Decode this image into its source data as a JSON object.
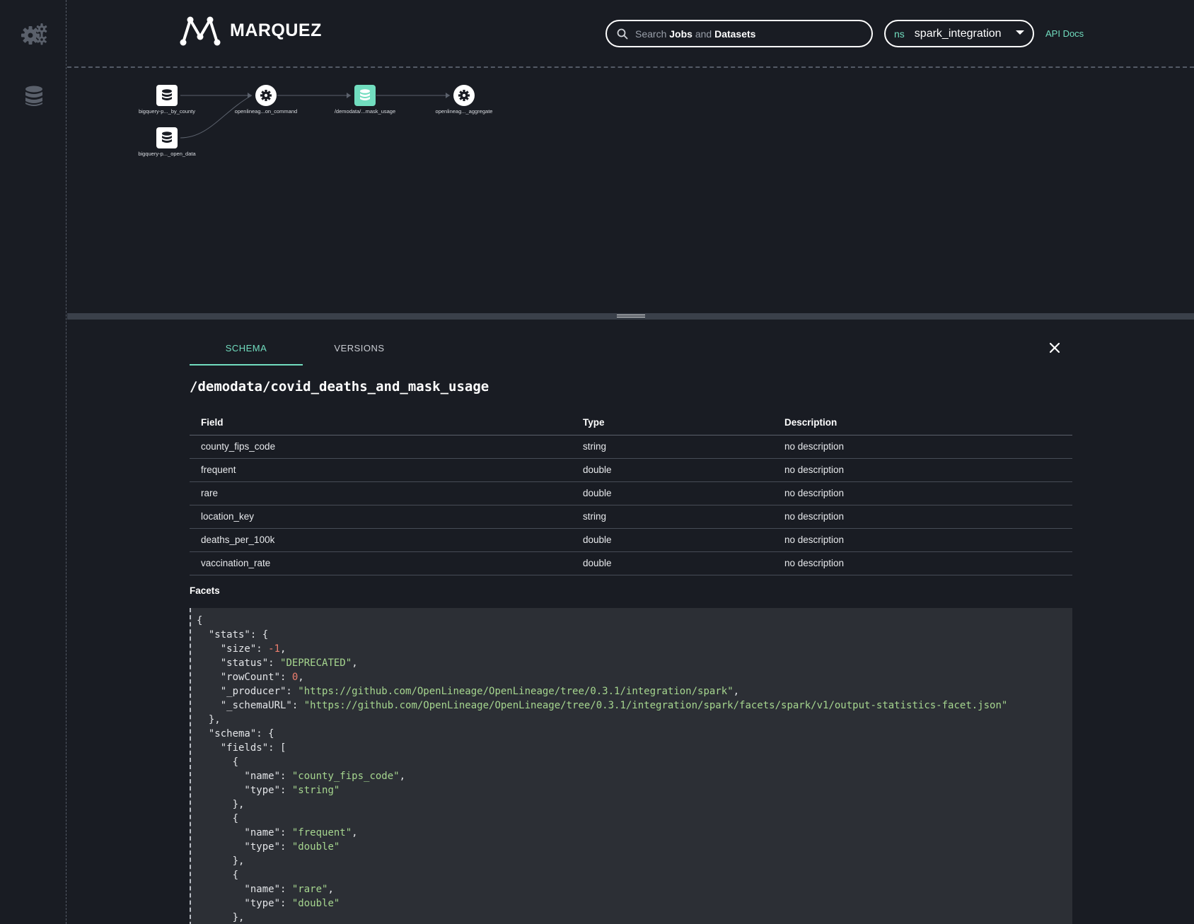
{
  "brand": {
    "name": "MARQUEZ"
  },
  "search": {
    "prefix": "Search ",
    "jobs": "Jobs",
    "and": " and ",
    "datasets": "Datasets"
  },
  "namespace": {
    "label": "ns",
    "value": "spark_integration"
  },
  "header": {
    "api_docs": "API Docs"
  },
  "graph": {
    "nodes": [
      {
        "label": "bigquery-p..._by_county",
        "kind": "dataset"
      },
      {
        "label": "bigquery-p..._open_data",
        "kind": "dataset"
      },
      {
        "label": "openlineag...on_command",
        "kind": "job"
      },
      {
        "label": "/demodata/...mask_usage",
        "kind": "dataset",
        "selected": true
      },
      {
        "label": "openlineag..._aggregate",
        "kind": "job"
      }
    ]
  },
  "panel": {
    "tabs": [
      {
        "label": "SCHEMA",
        "active": true
      },
      {
        "label": "VERSIONS",
        "active": false
      }
    ],
    "title": "/demodata/covid_deaths_and_mask_usage",
    "columns": {
      "field": "Field",
      "type": "Type",
      "description": "Description"
    },
    "rows": [
      {
        "field": "county_fips_code",
        "type": "string",
        "description": "no description"
      },
      {
        "field": "frequent",
        "type": "double",
        "description": "no description"
      },
      {
        "field": "rare",
        "type": "double",
        "description": "no description"
      },
      {
        "field": "location_key",
        "type": "string",
        "description": "no description"
      },
      {
        "field": "deaths_per_100k",
        "type": "double",
        "description": "no description"
      },
      {
        "field": "vaccination_rate",
        "type": "double",
        "description": "no description"
      }
    ],
    "facets_label": "Facets",
    "facets": {
      "stats": {
        "size": -1,
        "status": "DEPRECATED",
        "rowCount": 0,
        "_producer": "https://github.com/OpenLineage/OpenLineage/tree/0.3.1/integration/spark",
        "_schemaURL": "https://github.com/OpenLineage/OpenLineage/tree/0.3.1/integration/spark/facets/spark/v1/output-statistics-facet.json"
      },
      "schema_fields": [
        {
          "name": "county_fips_code",
          "type": "string"
        },
        {
          "name": "frequent",
          "type": "double"
        },
        {
          "name": "rare",
          "type": "double"
        }
      ]
    }
  },
  "colors": {
    "accent": "#71ddbf",
    "background": "#191c23",
    "code_bg": "#2c2f35"
  },
  "icons": {
    "sidebar": [
      "gears-icon",
      "database-icon"
    ],
    "search": "search-icon",
    "close": "close-icon"
  }
}
